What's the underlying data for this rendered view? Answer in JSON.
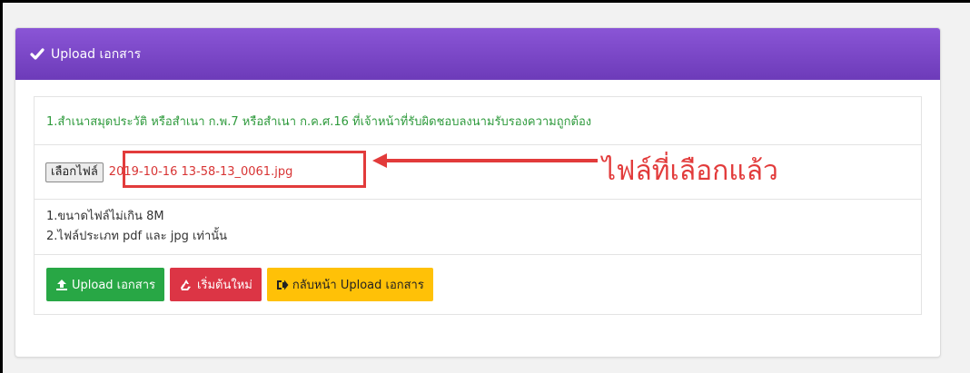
{
  "header": {
    "title": "Upload เอกสาร",
    "icon": "badge-check-icon"
  },
  "requirement": {
    "text": "1.สำเนาสมุดประวัติ หรือสำเนา ก.พ.7 หรือสำเนา ก.ค.ศ.16 ที่เจ้าหน้าที่รับผิดชอบลงนามรับรองความถูกต้อง"
  },
  "file": {
    "button_label": "เลือกไฟล์",
    "selected_name": "2019-10-16 13-58-13_0061.jpg"
  },
  "annotation": {
    "text": "ไฟล์ที่เลือกแล้ว"
  },
  "rules": {
    "items": [
      "1.ขนาดไฟล์ไม่เกิน 8M",
      "2.ไฟล์ประเภท pdf และ jpg เท่านั้น"
    ]
  },
  "actions": {
    "upload_label": "Upload เอกสาร",
    "reset_label": "เริ่มต้นใหม่",
    "back_label": "กลับหน้า Upload เอกสาร"
  },
  "colors": {
    "header": "#7b48c8",
    "success": "#28a745",
    "danger": "#dc3545",
    "warning": "#ffc107",
    "annotation": "#e23b3b",
    "requirement_text": "#2e9a3c"
  }
}
